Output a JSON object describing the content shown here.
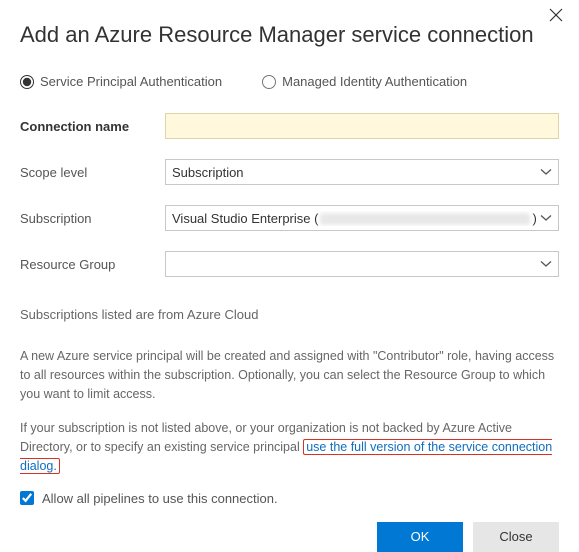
{
  "title": "Add an Azure Resource Manager service connection",
  "auth_options": {
    "service_principal": "Service Principal Authentication",
    "managed_identity": "Managed Identity Authentication",
    "selected": "service_principal"
  },
  "fields": {
    "connection_name": {
      "label": "Connection name",
      "value": ""
    },
    "scope_level": {
      "label": "Scope level",
      "value": "Subscription"
    },
    "subscription": {
      "label": "Subscription",
      "prefix": "Visual Studio Enterprise (",
      "suffix": ")"
    },
    "resource_group": {
      "label": "Resource Group",
      "value": ""
    }
  },
  "notes": {
    "cloud_source": "Subscriptions listed are from Azure Cloud",
    "principal_desc": "A new Azure service principal will be created and assigned with \"Contributor\" role, having access to all resources within the subscription. Optionally, you can select the Resource Group to which you want to limit access.",
    "fallback_prefix": "If your subscription is not listed above, or your organization is not backed by Azure Active Directory, or to specify an existing service principal ",
    "fallback_link": "use the full version of the service connection dialog."
  },
  "allow_all_pipelines": {
    "label": "Allow all pipelines to use this connection.",
    "checked": true
  },
  "buttons": {
    "ok": "OK",
    "close": "Close"
  }
}
